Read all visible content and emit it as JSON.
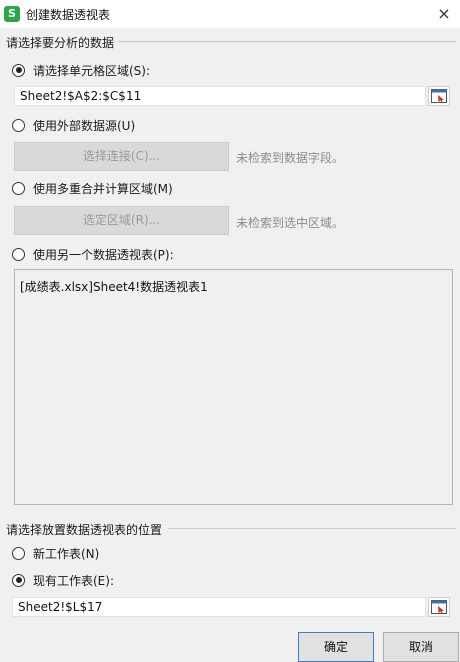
{
  "window": {
    "title": "创建数据透视表",
    "app_icon_letter": "S",
    "close_glyph": "×"
  },
  "source_section": {
    "label": "请选择要分析的数据",
    "option_range": {
      "label": "请选择单元格区域(S):",
      "checked": true
    },
    "range_value": "Sheet2!$A$2:$C$11",
    "option_external": {
      "label": "使用外部数据源(U)",
      "checked": false
    },
    "select_connection_button": "选择连接(C)...",
    "external_hint": "未检索到数据字段。",
    "option_multi": {
      "label": "使用多重合并计算区域(M)",
      "checked": false
    },
    "select_area_button": "选定区域(R)...",
    "multi_hint": "未检索到选中区域。",
    "option_pivot": {
      "label": "使用另一个数据透视表(P):",
      "checked": false
    },
    "pivot_list_item": "[成绩表.xlsx]Sheet4!数据透视表1"
  },
  "placement_section": {
    "label": "请选择放置数据透视表的位置",
    "option_new_sheet": {
      "label": "新工作表(N)",
      "checked": false
    },
    "option_existing_sheet": {
      "label": "现有工作表(E):",
      "checked": true
    },
    "location_value": "Sheet2!$L$17"
  },
  "buttons": {
    "ok": "确定",
    "cancel": "取消"
  },
  "colors": {
    "app_icon": "#2aa845",
    "ok_border": "#3c7fd1"
  }
}
